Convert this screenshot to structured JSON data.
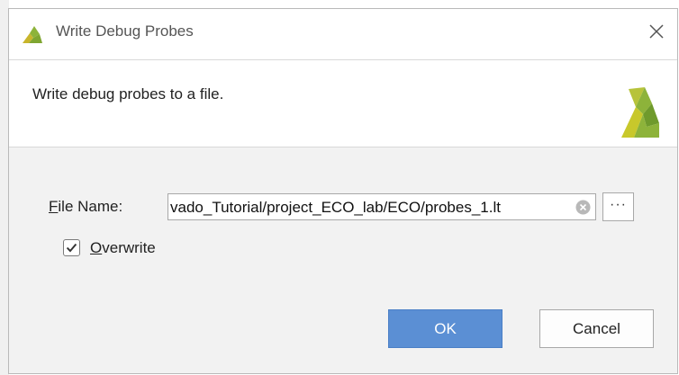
{
  "window": {
    "title": "Write Debug Probes",
    "title_icon": "xilinx-logo-icon",
    "close_icon": "close-icon"
  },
  "header": {
    "description": "Write debug probes to a file.",
    "logo_icon": "xilinx-logo-icon"
  },
  "form": {
    "file_name_label_mnemonic": "F",
    "file_name_label_rest": "ile Name:",
    "file_name_value": "vado_Tutorial/project_ECO_lab/ECO/probes_1.lt",
    "clear_icon": "clear-icon",
    "browse_label": "···",
    "overwrite_mnemonic": "O",
    "overwrite_rest": "verwrite",
    "overwrite_checked": true
  },
  "buttons": {
    "ok_label": "OK",
    "cancel_label": "Cancel"
  },
  "colors": {
    "ok_button": "#5b8fd4",
    "logo_green": "#8db33a",
    "logo_yellow": "#c8c82b"
  }
}
